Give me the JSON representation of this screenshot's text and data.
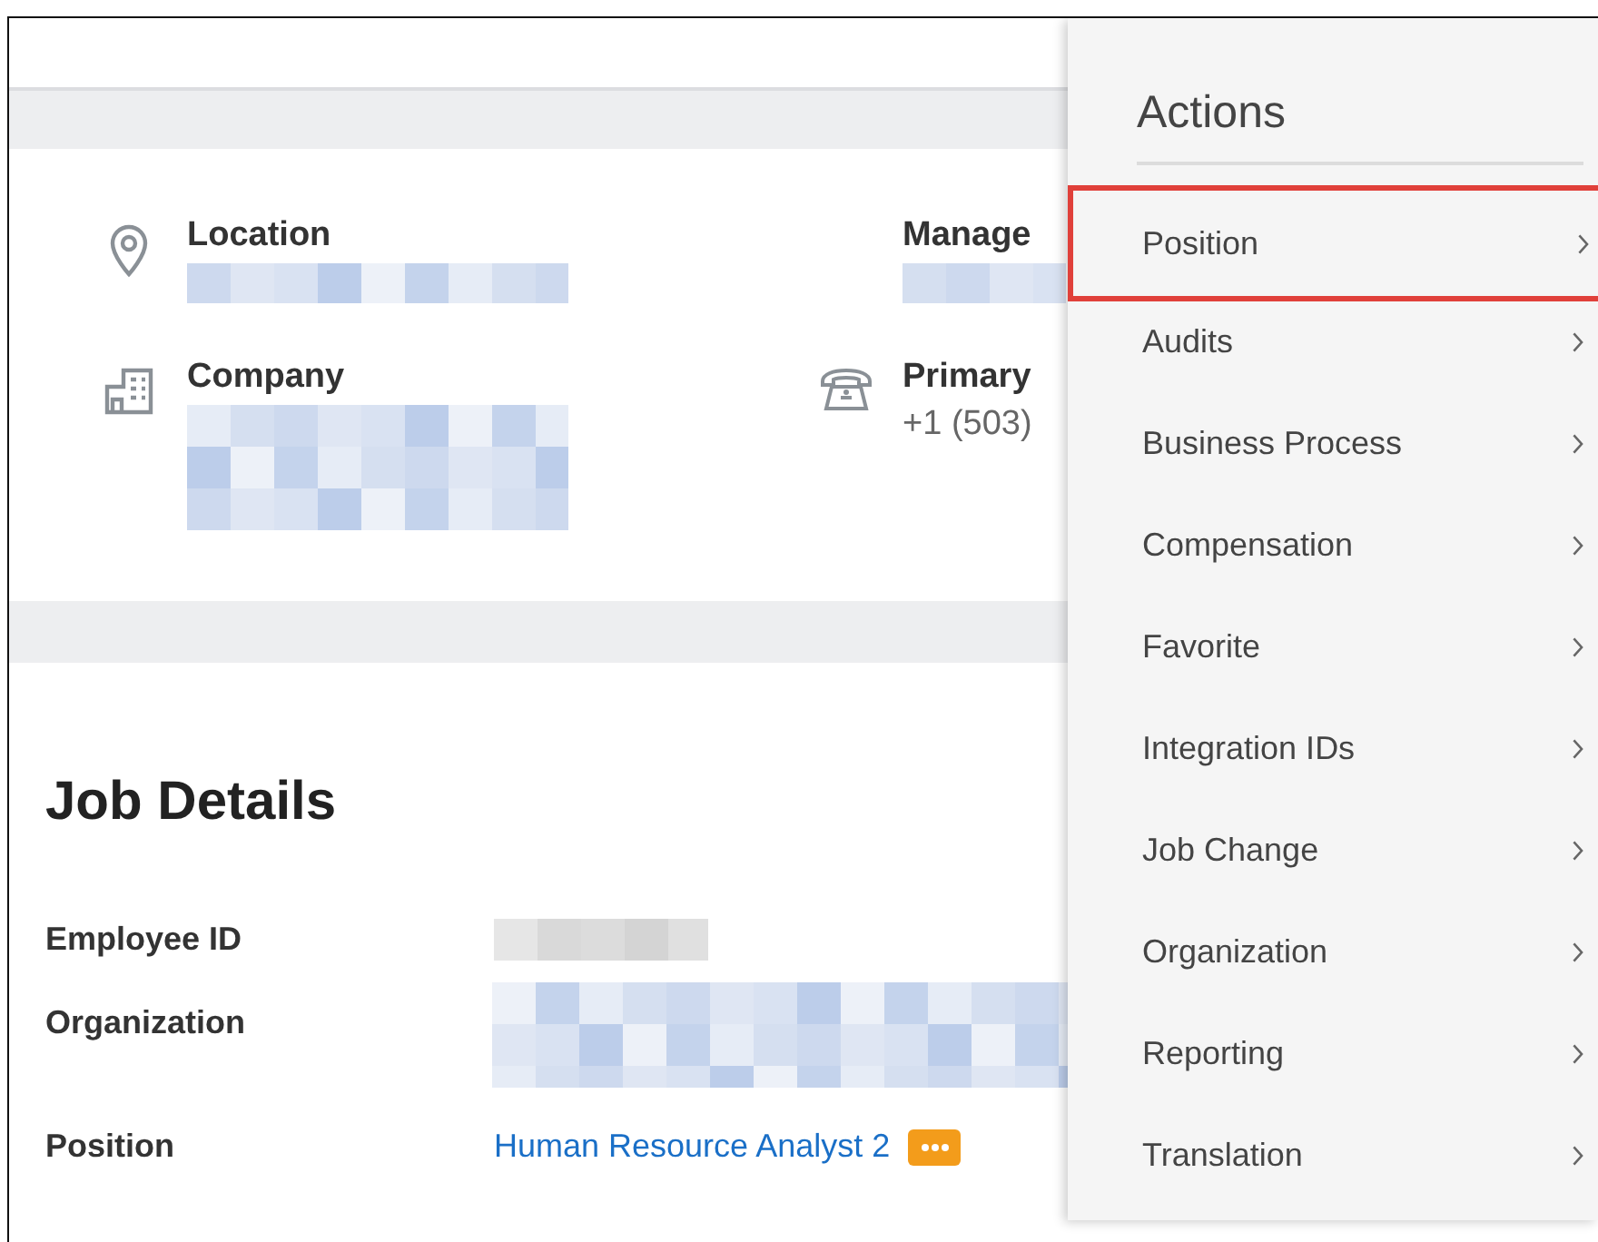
{
  "summary": {
    "fields": [
      {
        "label": "Location"
      },
      {
        "label": "Manage"
      },
      {
        "label": "Company"
      },
      {
        "label": "Primary",
        "value": "+1 (503)"
      }
    ]
  },
  "job_details": {
    "title": "Job Details",
    "rows": [
      {
        "label": "Employee ID",
        "kind": "hidden"
      },
      {
        "label": "Organization",
        "kind": "hidden"
      },
      {
        "label": "Position",
        "kind": "link",
        "value": "Human Resource Analyst 2"
      }
    ]
  },
  "actions_menu": {
    "title": "Actions",
    "items": [
      {
        "label": "Position",
        "selected": true
      },
      {
        "label": "Audits",
        "selected": false
      },
      {
        "label": "Business Process",
        "selected": false
      },
      {
        "label": "Compensation",
        "selected": false
      },
      {
        "label": "Favorite",
        "selected": false
      },
      {
        "label": "Integration IDs",
        "selected": false
      },
      {
        "label": "Job Change",
        "selected": false
      },
      {
        "label": "Organization",
        "selected": false
      },
      {
        "label": "Reporting",
        "selected": false
      },
      {
        "label": "Translation",
        "selected": false
      }
    ]
  }
}
